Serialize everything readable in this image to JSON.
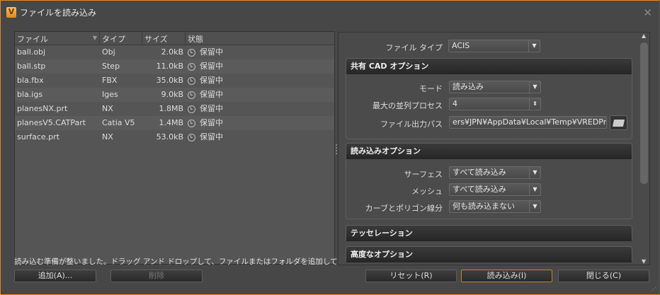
{
  "title": "ファイルを読み込み",
  "table": {
    "headers": [
      "ファイル",
      "タイプ",
      "サイズ",
      "状態"
    ],
    "rows": [
      {
        "file": "ball.obj",
        "type": "Obj",
        "size": "2.0kB",
        "status": "保留中"
      },
      {
        "file": "ball.stp",
        "type": "Step",
        "size": "11.0kB",
        "status": "保留中"
      },
      {
        "file": "bla.fbx",
        "type": "FBX",
        "size": "35.0kB",
        "status": "保留中"
      },
      {
        "file": "bla.igs",
        "type": "Iges",
        "size": "9.0kB",
        "status": "保留中"
      },
      {
        "file": "planesNX.prt",
        "type": "NX",
        "size": "1.8MB",
        "status": "保留中"
      },
      {
        "file": "planesV5.CATPart",
        "type": "Catia V5",
        "size": "1.4MB",
        "status": "保留中"
      },
      {
        "file": "surface.prt",
        "type": "NX",
        "size": "53.0kB",
        "status": "保留中"
      }
    ]
  },
  "status_text": "読み込む準備が整いました。ドラッグ アンド ドロップして、ファイルまたはフォルダを追加してください。",
  "buttons": {
    "add": "追加(A)...",
    "remove": "削除",
    "reset": "リセット(R)",
    "import": "読み込み(I)",
    "close": "閉じる(C)"
  },
  "options": {
    "file_type_label": "ファイル タイプ",
    "file_type": "ACIS",
    "cad": {
      "title": "共有 CAD オプション",
      "mode_label": "モード",
      "mode": "読み込み",
      "proc_label": "最大の並列プロセス",
      "proc": "4",
      "path_label": "ファイル出力パス",
      "path": "ers¥JPN¥AppData¥Local¥Temp¥VREDPro"
    },
    "import": {
      "title": "読み込みオプション",
      "surface_label": "サーフェス",
      "surface": "すべて読み込み",
      "mesh_label": "メッシュ",
      "mesh": "すべて読み込み",
      "curve_label": "カーブとポリゴン線分",
      "curve": "何も読み込まない"
    },
    "tess_title": "テッセレーション",
    "adv_title": "高度なオプション"
  }
}
